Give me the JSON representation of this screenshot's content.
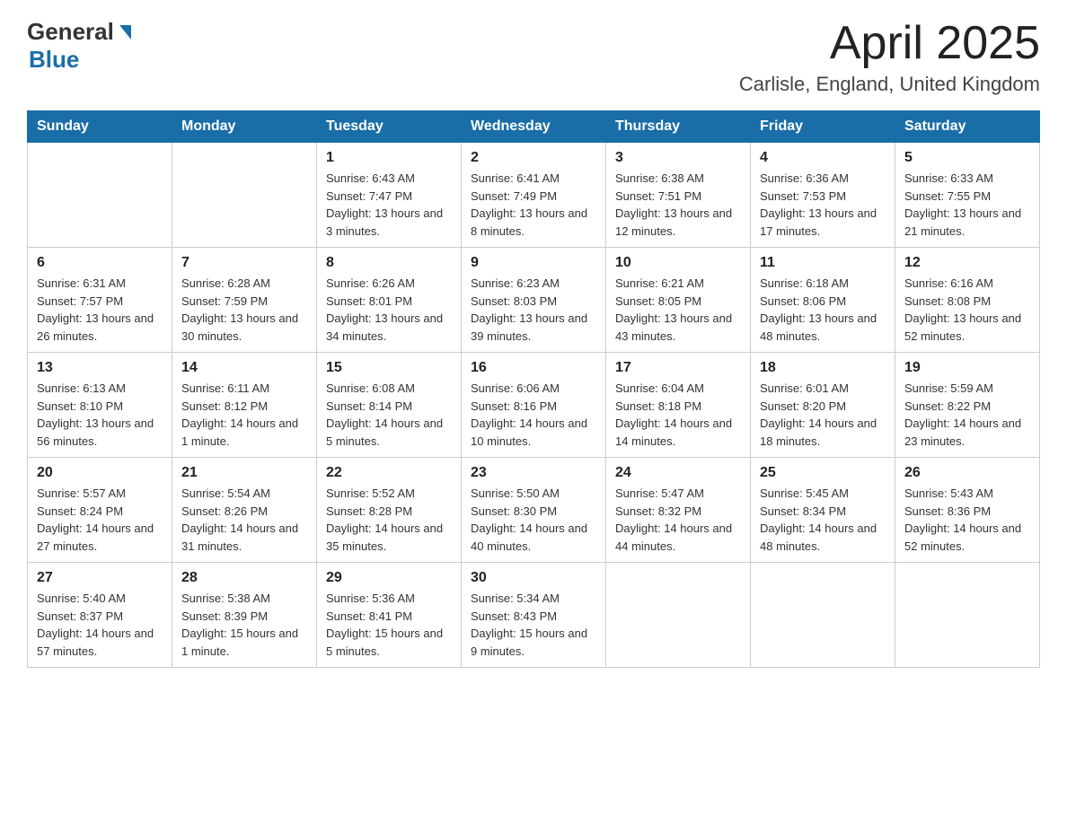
{
  "header": {
    "logo": {
      "general": "General",
      "blue": "Blue"
    },
    "title": "April 2025",
    "location": "Carlisle, England, United Kingdom"
  },
  "weekdays": [
    "Sunday",
    "Monday",
    "Tuesday",
    "Wednesday",
    "Thursday",
    "Friday",
    "Saturday"
  ],
  "weeks": [
    [
      {
        "day": "",
        "sunrise": "",
        "sunset": "",
        "daylight": ""
      },
      {
        "day": "",
        "sunrise": "",
        "sunset": "",
        "daylight": ""
      },
      {
        "day": "1",
        "sunrise": "Sunrise: 6:43 AM",
        "sunset": "Sunset: 7:47 PM",
        "daylight": "Daylight: 13 hours and 3 minutes."
      },
      {
        "day": "2",
        "sunrise": "Sunrise: 6:41 AM",
        "sunset": "Sunset: 7:49 PM",
        "daylight": "Daylight: 13 hours and 8 minutes."
      },
      {
        "day": "3",
        "sunrise": "Sunrise: 6:38 AM",
        "sunset": "Sunset: 7:51 PM",
        "daylight": "Daylight: 13 hours and 12 minutes."
      },
      {
        "day": "4",
        "sunrise": "Sunrise: 6:36 AM",
        "sunset": "Sunset: 7:53 PM",
        "daylight": "Daylight: 13 hours and 17 minutes."
      },
      {
        "day": "5",
        "sunrise": "Sunrise: 6:33 AM",
        "sunset": "Sunset: 7:55 PM",
        "daylight": "Daylight: 13 hours and 21 minutes."
      }
    ],
    [
      {
        "day": "6",
        "sunrise": "Sunrise: 6:31 AM",
        "sunset": "Sunset: 7:57 PM",
        "daylight": "Daylight: 13 hours and 26 minutes."
      },
      {
        "day": "7",
        "sunrise": "Sunrise: 6:28 AM",
        "sunset": "Sunset: 7:59 PM",
        "daylight": "Daylight: 13 hours and 30 minutes."
      },
      {
        "day": "8",
        "sunrise": "Sunrise: 6:26 AM",
        "sunset": "Sunset: 8:01 PM",
        "daylight": "Daylight: 13 hours and 34 minutes."
      },
      {
        "day": "9",
        "sunrise": "Sunrise: 6:23 AM",
        "sunset": "Sunset: 8:03 PM",
        "daylight": "Daylight: 13 hours and 39 minutes."
      },
      {
        "day": "10",
        "sunrise": "Sunrise: 6:21 AM",
        "sunset": "Sunset: 8:05 PM",
        "daylight": "Daylight: 13 hours and 43 minutes."
      },
      {
        "day": "11",
        "sunrise": "Sunrise: 6:18 AM",
        "sunset": "Sunset: 8:06 PM",
        "daylight": "Daylight: 13 hours and 48 minutes."
      },
      {
        "day": "12",
        "sunrise": "Sunrise: 6:16 AM",
        "sunset": "Sunset: 8:08 PM",
        "daylight": "Daylight: 13 hours and 52 minutes."
      }
    ],
    [
      {
        "day": "13",
        "sunrise": "Sunrise: 6:13 AM",
        "sunset": "Sunset: 8:10 PM",
        "daylight": "Daylight: 13 hours and 56 minutes."
      },
      {
        "day": "14",
        "sunrise": "Sunrise: 6:11 AM",
        "sunset": "Sunset: 8:12 PM",
        "daylight": "Daylight: 14 hours and 1 minute."
      },
      {
        "day": "15",
        "sunrise": "Sunrise: 6:08 AM",
        "sunset": "Sunset: 8:14 PM",
        "daylight": "Daylight: 14 hours and 5 minutes."
      },
      {
        "day": "16",
        "sunrise": "Sunrise: 6:06 AM",
        "sunset": "Sunset: 8:16 PM",
        "daylight": "Daylight: 14 hours and 10 minutes."
      },
      {
        "day": "17",
        "sunrise": "Sunrise: 6:04 AM",
        "sunset": "Sunset: 8:18 PM",
        "daylight": "Daylight: 14 hours and 14 minutes."
      },
      {
        "day": "18",
        "sunrise": "Sunrise: 6:01 AM",
        "sunset": "Sunset: 8:20 PM",
        "daylight": "Daylight: 14 hours and 18 minutes."
      },
      {
        "day": "19",
        "sunrise": "Sunrise: 5:59 AM",
        "sunset": "Sunset: 8:22 PM",
        "daylight": "Daylight: 14 hours and 23 minutes."
      }
    ],
    [
      {
        "day": "20",
        "sunrise": "Sunrise: 5:57 AM",
        "sunset": "Sunset: 8:24 PM",
        "daylight": "Daylight: 14 hours and 27 minutes."
      },
      {
        "day": "21",
        "sunrise": "Sunrise: 5:54 AM",
        "sunset": "Sunset: 8:26 PM",
        "daylight": "Daylight: 14 hours and 31 minutes."
      },
      {
        "day": "22",
        "sunrise": "Sunrise: 5:52 AM",
        "sunset": "Sunset: 8:28 PM",
        "daylight": "Daylight: 14 hours and 35 minutes."
      },
      {
        "day": "23",
        "sunrise": "Sunrise: 5:50 AM",
        "sunset": "Sunset: 8:30 PM",
        "daylight": "Daylight: 14 hours and 40 minutes."
      },
      {
        "day": "24",
        "sunrise": "Sunrise: 5:47 AM",
        "sunset": "Sunset: 8:32 PM",
        "daylight": "Daylight: 14 hours and 44 minutes."
      },
      {
        "day": "25",
        "sunrise": "Sunrise: 5:45 AM",
        "sunset": "Sunset: 8:34 PM",
        "daylight": "Daylight: 14 hours and 48 minutes."
      },
      {
        "day": "26",
        "sunrise": "Sunrise: 5:43 AM",
        "sunset": "Sunset: 8:36 PM",
        "daylight": "Daylight: 14 hours and 52 minutes."
      }
    ],
    [
      {
        "day": "27",
        "sunrise": "Sunrise: 5:40 AM",
        "sunset": "Sunset: 8:37 PM",
        "daylight": "Daylight: 14 hours and 57 minutes."
      },
      {
        "day": "28",
        "sunrise": "Sunrise: 5:38 AM",
        "sunset": "Sunset: 8:39 PM",
        "daylight": "Daylight: 15 hours and 1 minute."
      },
      {
        "day": "29",
        "sunrise": "Sunrise: 5:36 AM",
        "sunset": "Sunset: 8:41 PM",
        "daylight": "Daylight: 15 hours and 5 minutes."
      },
      {
        "day": "30",
        "sunrise": "Sunrise: 5:34 AM",
        "sunset": "Sunset: 8:43 PM",
        "daylight": "Daylight: 15 hours and 9 minutes."
      },
      {
        "day": "",
        "sunrise": "",
        "sunset": "",
        "daylight": ""
      },
      {
        "day": "",
        "sunrise": "",
        "sunset": "",
        "daylight": ""
      },
      {
        "day": "",
        "sunrise": "",
        "sunset": "",
        "daylight": ""
      }
    ]
  ]
}
